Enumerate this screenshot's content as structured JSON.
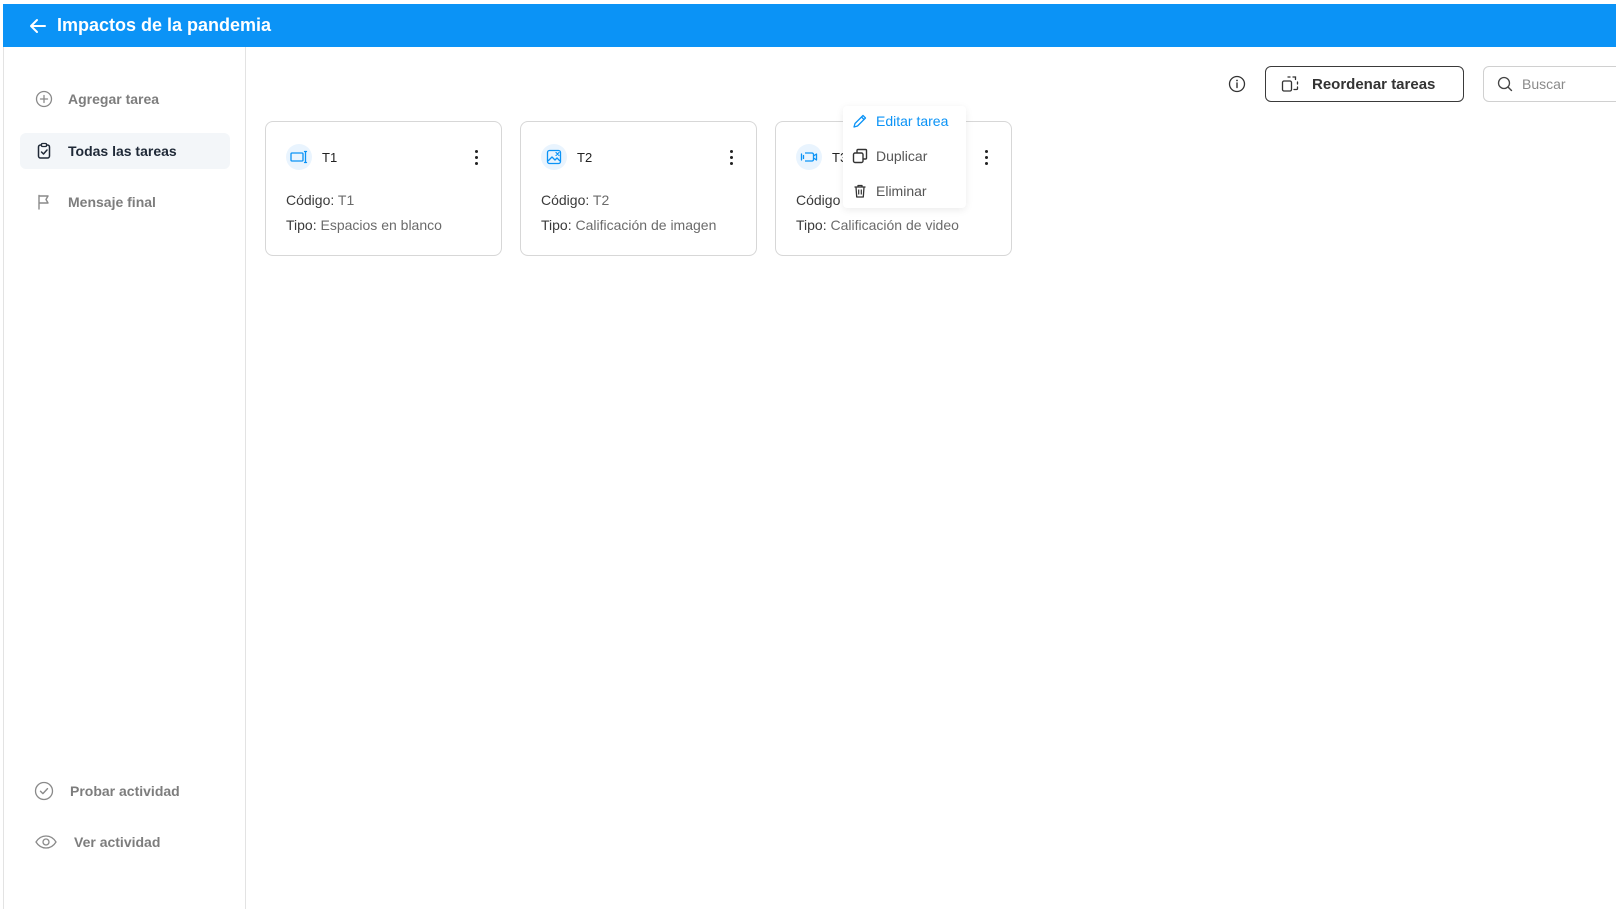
{
  "header": {
    "title": "Impactos de la pandemia"
  },
  "sidebar": {
    "items": [
      {
        "label": "Agregar tarea",
        "icon": "plus-circle-icon"
      },
      {
        "label": "Todas las tareas",
        "icon": "clipboard-check-icon",
        "active": true
      },
      {
        "label": "Mensaje final",
        "icon": "flag-icon"
      }
    ],
    "bottom_items": [
      {
        "label": "Probar actividad",
        "icon": "check-circle-icon"
      },
      {
        "label": "Ver actividad",
        "icon": "eye-icon"
      }
    ]
  },
  "toolbar": {
    "reorder_label": "Reordenar tareas",
    "search_placeholder": "Buscar"
  },
  "cards": [
    {
      "name": "T1",
      "code_label": "Código:",
      "code": "T1",
      "type_label": "Tipo:",
      "type": "Espacios en blanco",
      "icon": "fill-blanks-icon"
    },
    {
      "name": "T2",
      "code_label": "Código:",
      "code": "T2",
      "type_label": "Tipo:",
      "type": "Calificación de imagen",
      "icon": "image-rating-icon"
    },
    {
      "name": "T3",
      "code_label": "Código",
      "type_label": "Tipo:",
      "type": "Calificación de video",
      "icon": "video-rating-icon"
    }
  ],
  "dropdown": {
    "items": [
      {
        "label": "Editar tarea",
        "icon": "pencil-icon"
      },
      {
        "label": "Duplicar",
        "icon": "copy-icon"
      },
      {
        "label": "Eliminar",
        "icon": "trash-icon"
      }
    ]
  },
  "colors": {
    "accent": "#0b93f6",
    "sidebar_active": "#f3f6f9"
  }
}
